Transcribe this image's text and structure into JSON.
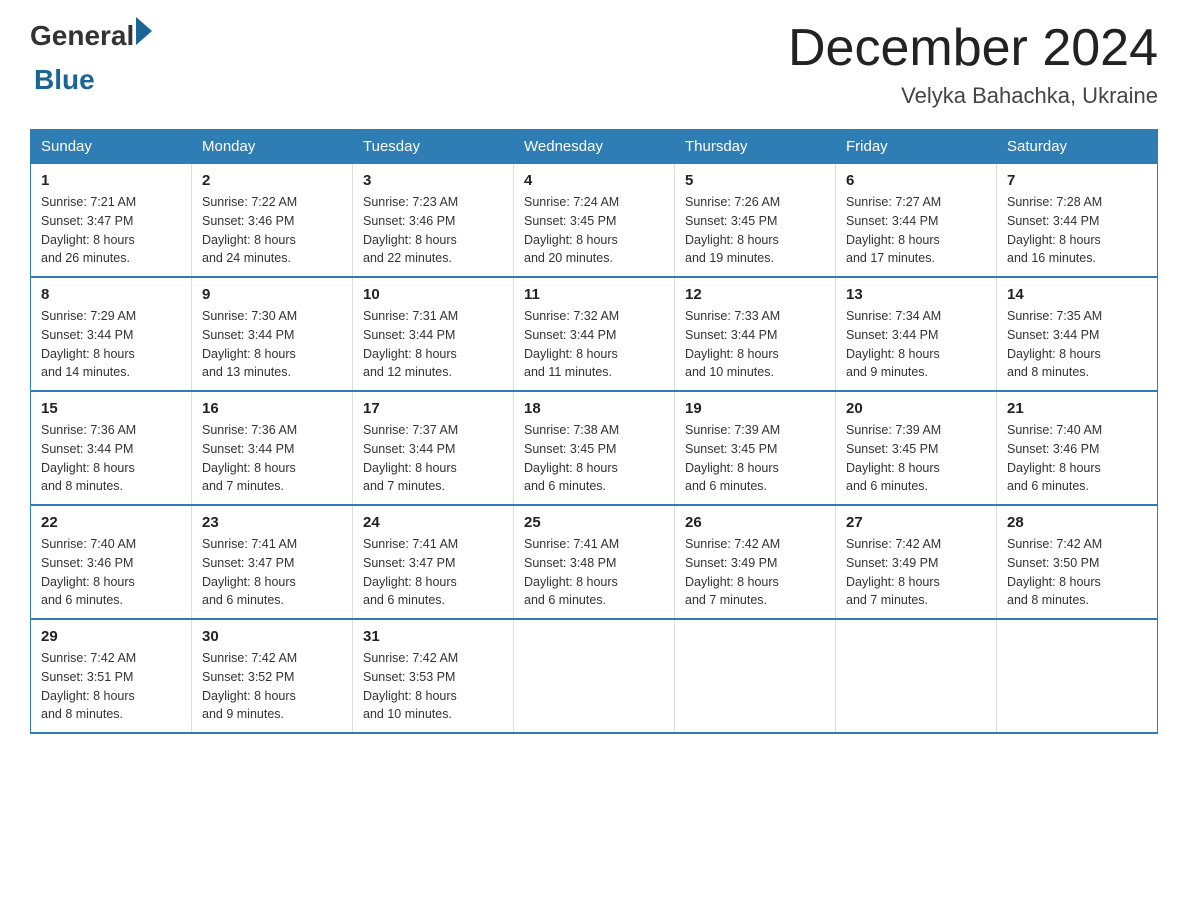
{
  "header": {
    "logo_general": "General",
    "logo_blue": "Blue",
    "month_title": "December 2024",
    "location": "Velyka Bahachka, Ukraine"
  },
  "weekdays": [
    "Sunday",
    "Monday",
    "Tuesday",
    "Wednesday",
    "Thursday",
    "Friday",
    "Saturday"
  ],
  "weeks": [
    [
      {
        "day": "1",
        "info": "Sunrise: 7:21 AM\nSunset: 3:47 PM\nDaylight: 8 hours\nand 26 minutes."
      },
      {
        "day": "2",
        "info": "Sunrise: 7:22 AM\nSunset: 3:46 PM\nDaylight: 8 hours\nand 24 minutes."
      },
      {
        "day": "3",
        "info": "Sunrise: 7:23 AM\nSunset: 3:46 PM\nDaylight: 8 hours\nand 22 minutes."
      },
      {
        "day": "4",
        "info": "Sunrise: 7:24 AM\nSunset: 3:45 PM\nDaylight: 8 hours\nand 20 minutes."
      },
      {
        "day": "5",
        "info": "Sunrise: 7:26 AM\nSunset: 3:45 PM\nDaylight: 8 hours\nand 19 minutes."
      },
      {
        "day": "6",
        "info": "Sunrise: 7:27 AM\nSunset: 3:44 PM\nDaylight: 8 hours\nand 17 minutes."
      },
      {
        "day": "7",
        "info": "Sunrise: 7:28 AM\nSunset: 3:44 PM\nDaylight: 8 hours\nand 16 minutes."
      }
    ],
    [
      {
        "day": "8",
        "info": "Sunrise: 7:29 AM\nSunset: 3:44 PM\nDaylight: 8 hours\nand 14 minutes."
      },
      {
        "day": "9",
        "info": "Sunrise: 7:30 AM\nSunset: 3:44 PM\nDaylight: 8 hours\nand 13 minutes."
      },
      {
        "day": "10",
        "info": "Sunrise: 7:31 AM\nSunset: 3:44 PM\nDaylight: 8 hours\nand 12 minutes."
      },
      {
        "day": "11",
        "info": "Sunrise: 7:32 AM\nSunset: 3:44 PM\nDaylight: 8 hours\nand 11 minutes."
      },
      {
        "day": "12",
        "info": "Sunrise: 7:33 AM\nSunset: 3:44 PM\nDaylight: 8 hours\nand 10 minutes."
      },
      {
        "day": "13",
        "info": "Sunrise: 7:34 AM\nSunset: 3:44 PM\nDaylight: 8 hours\nand 9 minutes."
      },
      {
        "day": "14",
        "info": "Sunrise: 7:35 AM\nSunset: 3:44 PM\nDaylight: 8 hours\nand 8 minutes."
      }
    ],
    [
      {
        "day": "15",
        "info": "Sunrise: 7:36 AM\nSunset: 3:44 PM\nDaylight: 8 hours\nand 8 minutes."
      },
      {
        "day": "16",
        "info": "Sunrise: 7:36 AM\nSunset: 3:44 PM\nDaylight: 8 hours\nand 7 minutes."
      },
      {
        "day": "17",
        "info": "Sunrise: 7:37 AM\nSunset: 3:44 PM\nDaylight: 8 hours\nand 7 minutes."
      },
      {
        "day": "18",
        "info": "Sunrise: 7:38 AM\nSunset: 3:45 PM\nDaylight: 8 hours\nand 6 minutes."
      },
      {
        "day": "19",
        "info": "Sunrise: 7:39 AM\nSunset: 3:45 PM\nDaylight: 8 hours\nand 6 minutes."
      },
      {
        "day": "20",
        "info": "Sunrise: 7:39 AM\nSunset: 3:45 PM\nDaylight: 8 hours\nand 6 minutes."
      },
      {
        "day": "21",
        "info": "Sunrise: 7:40 AM\nSunset: 3:46 PM\nDaylight: 8 hours\nand 6 minutes."
      }
    ],
    [
      {
        "day": "22",
        "info": "Sunrise: 7:40 AM\nSunset: 3:46 PM\nDaylight: 8 hours\nand 6 minutes."
      },
      {
        "day": "23",
        "info": "Sunrise: 7:41 AM\nSunset: 3:47 PM\nDaylight: 8 hours\nand 6 minutes."
      },
      {
        "day": "24",
        "info": "Sunrise: 7:41 AM\nSunset: 3:47 PM\nDaylight: 8 hours\nand 6 minutes."
      },
      {
        "day": "25",
        "info": "Sunrise: 7:41 AM\nSunset: 3:48 PM\nDaylight: 8 hours\nand 6 minutes."
      },
      {
        "day": "26",
        "info": "Sunrise: 7:42 AM\nSunset: 3:49 PM\nDaylight: 8 hours\nand 7 minutes."
      },
      {
        "day": "27",
        "info": "Sunrise: 7:42 AM\nSunset: 3:49 PM\nDaylight: 8 hours\nand 7 minutes."
      },
      {
        "day": "28",
        "info": "Sunrise: 7:42 AM\nSunset: 3:50 PM\nDaylight: 8 hours\nand 8 minutes."
      }
    ],
    [
      {
        "day": "29",
        "info": "Sunrise: 7:42 AM\nSunset: 3:51 PM\nDaylight: 8 hours\nand 8 minutes."
      },
      {
        "day": "30",
        "info": "Sunrise: 7:42 AM\nSunset: 3:52 PM\nDaylight: 8 hours\nand 9 minutes."
      },
      {
        "day": "31",
        "info": "Sunrise: 7:42 AM\nSunset: 3:53 PM\nDaylight: 8 hours\nand 10 minutes."
      },
      {
        "day": "",
        "info": ""
      },
      {
        "day": "",
        "info": ""
      },
      {
        "day": "",
        "info": ""
      },
      {
        "day": "",
        "info": ""
      }
    ]
  ]
}
